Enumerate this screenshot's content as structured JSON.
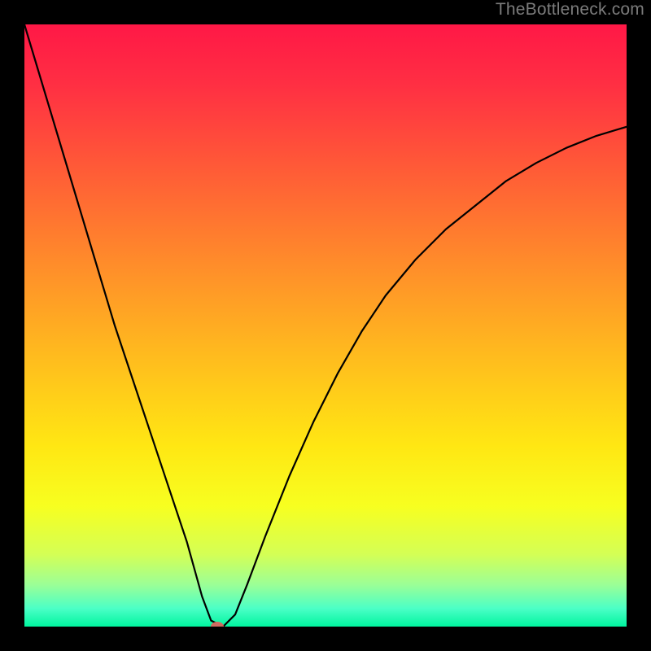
{
  "watermark": "TheBottleneck.com",
  "colors": {
    "frame": "#000000",
    "curve": "#000000",
    "dot": "#cf6b61",
    "watermark": "#7b7b7b",
    "gradient_stops": [
      {
        "offset": 0.0,
        "color": "#ff1846"
      },
      {
        "offset": 0.1,
        "color": "#ff2f43"
      },
      {
        "offset": 0.25,
        "color": "#ff5e36"
      },
      {
        "offset": 0.4,
        "color": "#ff8d2a"
      },
      {
        "offset": 0.55,
        "color": "#ffbb1e"
      },
      {
        "offset": 0.7,
        "color": "#ffe713"
      },
      {
        "offset": 0.8,
        "color": "#f7ff20"
      },
      {
        "offset": 0.88,
        "color": "#d4ff55"
      },
      {
        "offset": 0.93,
        "color": "#9cff96"
      },
      {
        "offset": 0.97,
        "color": "#4bffc6"
      },
      {
        "offset": 1.0,
        "color": "#00f59f"
      }
    ]
  },
  "chart_data": {
    "type": "line",
    "title": "",
    "xlabel": "",
    "ylabel": "",
    "xlim": [
      0,
      100
    ],
    "ylim": [
      0,
      100
    ],
    "series": [
      {
        "name": "bottleneck-curve",
        "x": [
          0,
          3,
          6,
          9,
          12,
          15,
          18,
          21,
          24,
          27,
          29.5,
          31,
          33,
          35,
          37,
          40,
          44,
          48,
          52,
          56,
          60,
          65,
          70,
          75,
          80,
          85,
          90,
          95,
          100
        ],
        "values": [
          100,
          90,
          80,
          70,
          60,
          50,
          41,
          32,
          23,
          14,
          5,
          1,
          0,
          2,
          7,
          15,
          25,
          34,
          42,
          49,
          55,
          61,
          66,
          70,
          74,
          77,
          79.5,
          81.5,
          83
        ]
      }
    ],
    "annotations": [
      {
        "name": "min-point",
        "x": 32,
        "y": 0
      }
    ]
  }
}
